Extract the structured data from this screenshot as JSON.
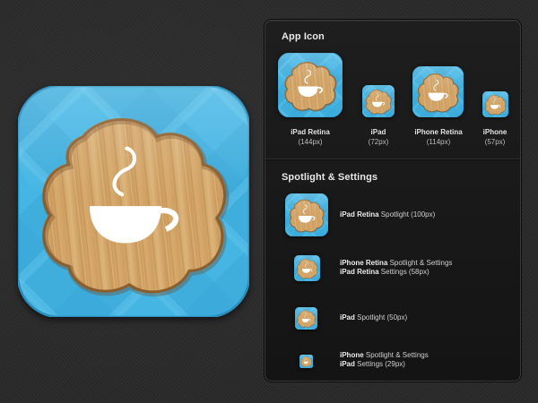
{
  "colors": {
    "background": "#2b2b2b",
    "panel": "#181818",
    "icon_blue": "#3fb4e3",
    "wood": "#d6a86a",
    "cup": "#ffffff"
  },
  "main_icon": {
    "icon": "coffee-cup-icon"
  },
  "app_icon_section": {
    "title": "App Icon",
    "items": [
      {
        "name": "iPad Retina",
        "size": "(144px)"
      },
      {
        "name": "iPad",
        "size": "(72px)"
      },
      {
        "name": "iPhone Retina",
        "size": "(114px)"
      },
      {
        "name": "iPhone",
        "size": "(57px)"
      }
    ]
  },
  "spotlight_section": {
    "title": "Spotlight & Settings",
    "items": [
      {
        "bold1": "iPad Retina",
        "text1": " Spotlight (100px)",
        "bold2": "",
        "text2": ""
      },
      {
        "bold1": "iPhone Retina",
        "text1": " Spotlight & Settings",
        "bold2": "iPad Retina",
        "text2": " Settings (58px)"
      },
      {
        "bold1": "iPad",
        "text1": " Spotlight (50px)",
        "bold2": "",
        "text2": ""
      },
      {
        "bold1": "iPhone",
        "text1": " Spotlight & Settings",
        "bold2": "iPad",
        "text2": " Settings (29px)"
      }
    ]
  }
}
